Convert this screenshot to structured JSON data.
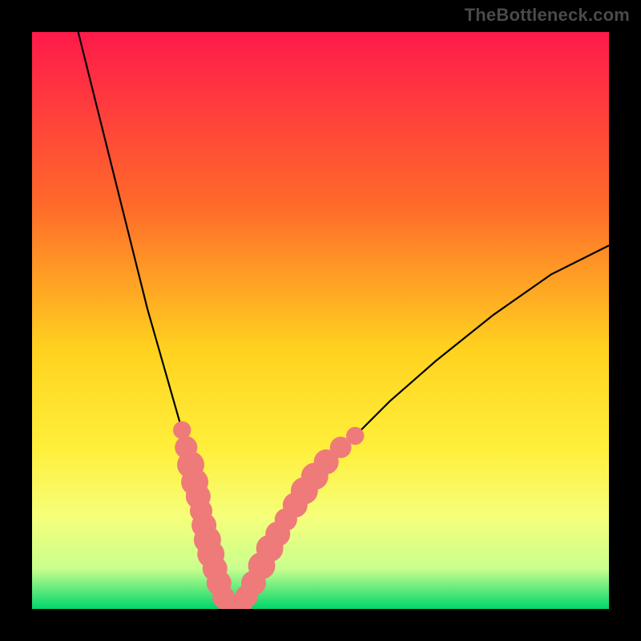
{
  "attribution": "TheBottleneck.com",
  "chart_data": {
    "type": "line",
    "title": "",
    "xlabel": "",
    "ylabel": "",
    "xlim": [
      0,
      100
    ],
    "ylim": [
      0,
      100
    ],
    "background_gradient_stops": [
      {
        "offset": 0,
        "color": "#ff1a4b"
      },
      {
        "offset": 30,
        "color": "#ff6a2a"
      },
      {
        "offset": 55,
        "color": "#ffd21f"
      },
      {
        "offset": 72,
        "color": "#ffef3a"
      },
      {
        "offset": 84,
        "color": "#f6ff7a"
      },
      {
        "offset": 93,
        "color": "#c9ff8e"
      },
      {
        "offset": 100,
        "color": "#00d66b"
      }
    ],
    "series": [
      {
        "name": "bottleneck-curve",
        "x": [
          8,
          10,
          12,
          14,
          16,
          18,
          20,
          22,
          24,
          26,
          27,
          28,
          29,
          30,
          31,
          32,
          33,
          34,
          35,
          36,
          38,
          40,
          44,
          48,
          55,
          62,
          70,
          80,
          90,
          100
        ],
        "y": [
          100,
          92,
          84,
          76,
          68,
          60,
          52,
          45,
          38,
          31,
          27,
          23,
          19,
          15,
          10,
          6,
          3,
          1,
          0,
          1,
          4,
          8,
          14,
          20,
          29,
          36,
          43,
          51,
          58,
          63
        ]
      }
    ],
    "markers": {
      "name": "highlighted-points",
      "color": "#ef7a7a",
      "points": [
        {
          "x": 26.0,
          "y": 31.0,
          "r": 1.0
        },
        {
          "x": 26.7,
          "y": 28.0,
          "r": 1.4
        },
        {
          "x": 27.5,
          "y": 25.0,
          "r": 1.8
        },
        {
          "x": 28.2,
          "y": 22.0,
          "r": 1.8
        },
        {
          "x": 28.8,
          "y": 19.5,
          "r": 1.6
        },
        {
          "x": 29.3,
          "y": 17.0,
          "r": 1.4
        },
        {
          "x": 29.8,
          "y": 14.5,
          "r": 1.6
        },
        {
          "x": 30.4,
          "y": 12.0,
          "r": 1.8
        },
        {
          "x": 31.0,
          "y": 9.5,
          "r": 1.8
        },
        {
          "x": 31.7,
          "y": 7.0,
          "r": 1.6
        },
        {
          "x": 32.4,
          "y": 4.5,
          "r": 1.6
        },
        {
          "x": 33.2,
          "y": 2.0,
          "r": 1.4
        },
        {
          "x": 34.2,
          "y": 0.8,
          "r": 1.4
        },
        {
          "x": 35.2,
          "y": 0.3,
          "r": 1.4
        },
        {
          "x": 36.2,
          "y": 0.8,
          "r": 1.4
        },
        {
          "x": 37.2,
          "y": 2.2,
          "r": 1.4
        },
        {
          "x": 38.4,
          "y": 4.5,
          "r": 1.6
        },
        {
          "x": 39.8,
          "y": 7.5,
          "r": 1.8
        },
        {
          "x": 41.2,
          "y": 10.5,
          "r": 1.8
        },
        {
          "x": 42.6,
          "y": 13.0,
          "r": 1.6
        },
        {
          "x": 44.0,
          "y": 15.5,
          "r": 1.4
        },
        {
          "x": 45.6,
          "y": 18.0,
          "r": 1.6
        },
        {
          "x": 47.2,
          "y": 20.5,
          "r": 1.8
        },
        {
          "x": 49.0,
          "y": 23.0,
          "r": 1.8
        },
        {
          "x": 51.0,
          "y": 25.5,
          "r": 1.6
        },
        {
          "x": 53.5,
          "y": 28.0,
          "r": 1.3
        },
        {
          "x": 56.0,
          "y": 30.0,
          "r": 1.0
        }
      ]
    }
  }
}
